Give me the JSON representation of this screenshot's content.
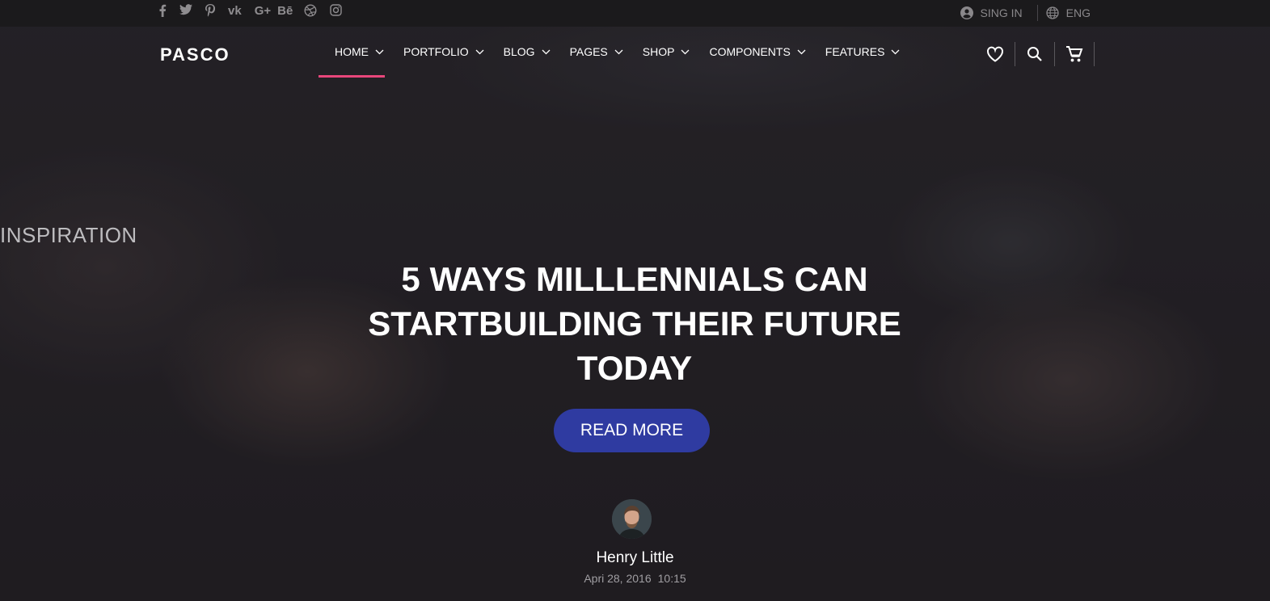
{
  "topbar": {
    "social_icons": [
      "facebook-icon",
      "twitter-icon",
      "pinterest-icon",
      "vk-icon",
      "google-plus-icon",
      "behance-icon",
      "dribbble-icon",
      "instagram-icon"
    ],
    "google_plus_text": "G+",
    "behance_text": "Bē",
    "vk_text": "vk",
    "sign_in": "SING IN",
    "language": "ENG"
  },
  "nav": {
    "logo": "PASCO",
    "items": [
      {
        "label": "HOME",
        "active": true
      },
      {
        "label": "PORTFOLIO"
      },
      {
        "label": "BLOG"
      },
      {
        "label": "PAGES"
      },
      {
        "label": "SHOP"
      },
      {
        "label": "COMPONENTS"
      },
      {
        "label": "FEATURES"
      }
    ],
    "icons": [
      "heart-icon",
      "search-icon",
      "cart-icon"
    ],
    "accent_color": "#e8467b"
  },
  "hero": {
    "category": "INSPIRATION",
    "headline": "5 WAYS MILLLENNIALS CAN STARTBUILDING THEIR FUTURE TODAY",
    "button": "READ MORE",
    "button_color": "#2f3ba1",
    "author": "Henry Little",
    "date": "Apri 28, 2016",
    "time": "10:15"
  }
}
